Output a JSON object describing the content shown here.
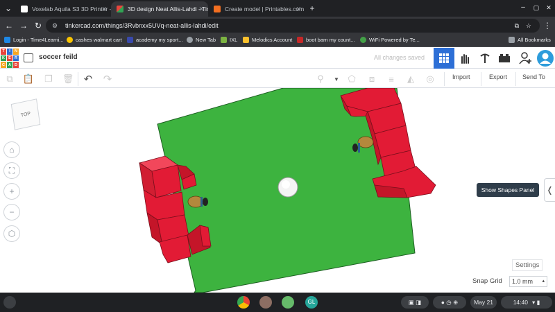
{
  "browser": {
    "tabs": [
      {
        "label": "Voxelab Aquila S3 3D Printer -",
        "active": false
      },
      {
        "label": "3D design Neat Allis-Lahdi - Tin",
        "active": true
      },
      {
        "label": "Create model | Printables.com",
        "active": false
      }
    ],
    "url": "tinkercad.com/things/3Rvbnxx5UVq-neat-allis-lahdi/edit",
    "bookmarks": [
      "Login - Time4Learni...",
      "cashes walmart cart",
      "academy my sport...",
      "New Tab",
      "IXL",
      "Melodics Account",
      "boot barn my count...",
      "WiFi Powered by Te..."
    ],
    "all_bookmarks": "All Bookmarks"
  },
  "tinkercad": {
    "logo_letters": [
      "TIN",
      "KER",
      "CAD"
    ],
    "design_title": "soccer feild",
    "save_status": "All changes saved",
    "toolbar": {
      "import": "Import",
      "export": "Export",
      "send_to": "Send To"
    },
    "viewcube_face": "TOP",
    "tooltip": "Show Shapes Panel",
    "settings": "Settings",
    "snap_grid_label": "Snap Grid",
    "snap_grid_value": "1.0 mm"
  },
  "taskbar": {
    "date": "May 21",
    "time": "14:40"
  },
  "colors": {
    "field": "#3db33f",
    "goal": "#e21b35",
    "accent": "#2d6fd6"
  }
}
